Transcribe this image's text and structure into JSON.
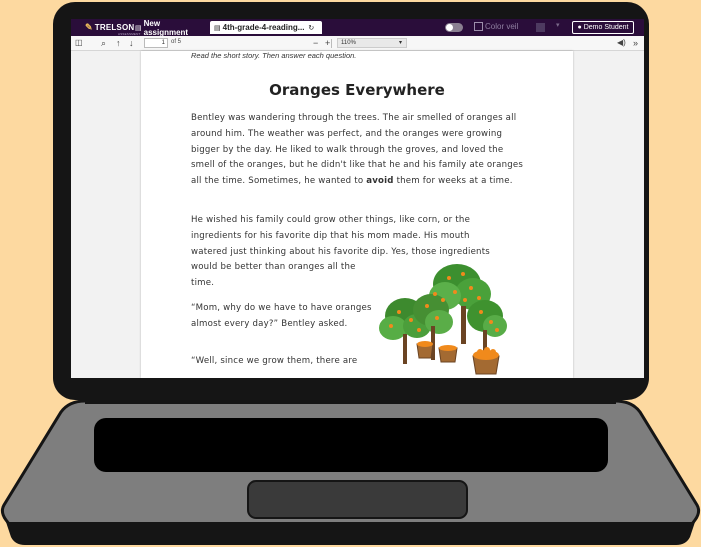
{
  "topbar": {
    "brand": "TRELSON",
    "brand_sub": "ASSESSMENT",
    "tab_new": "New assignment",
    "tab_active": "4th-grade-4-reading...",
    "color_veil_label": "Color veil",
    "user_label": "Demo Student"
  },
  "pdf_toolbar": {
    "page_current": "1",
    "page_of": "of 5",
    "zoom": "110%"
  },
  "document": {
    "instruction": "Read the short story.  Then answer each question.",
    "title": "Oranges Everywhere",
    "p1_before": "Bentley was wandering through the trees. The air smelled of oranges all around him. The weather was perfect, and the oranges were growing bigger by the day. He liked to walk through the groves, and loved the smell of the oranges, but he didn't like that he and his family ate oranges all the time. Sometimes, he wanted to ",
    "p1_bold": "avoid",
    "p1_after": " them for weeks at a time.",
    "p2_main": "He wished his family could grow other things, like corn, or the ingredients for his favorite dip that his mom made. His mouth watered just thinking about his favorite dip. Yes, those ingredients would be better than oranges all the",
    "p2_tail": "time.",
    "p3": "“Mom, why do we have to have oranges almost every day?” Bentley asked.",
    "p4": "“Well, since we grow them, there are"
  },
  "icons": {
    "brand": "pencil-logo-icon",
    "sidebar_toggle": "sidebar-toggle-icon",
    "search": "search-icon",
    "prev": "arrow-up-icon",
    "next": "arrow-down-icon",
    "zoom_out": "minus-icon",
    "zoom_in": "plus-icon",
    "speaker": "speaker-icon",
    "more": "double-chevron-right-icon",
    "user": "user-circle-icon"
  },
  "colors": {
    "background": "#fdd9a0",
    "topbar": "#2a0d3a",
    "laptop_body": "#808080"
  }
}
